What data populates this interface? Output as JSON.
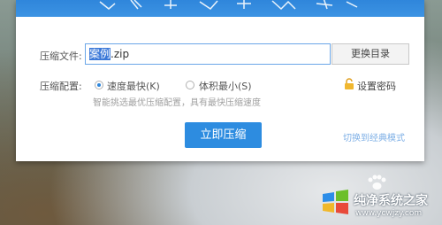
{
  "dialog": {
    "file_label": "压缩文件:",
    "file_name_selected": "案例",
    "file_name_ext": ".zip",
    "change_dir_label": "更换目录",
    "config_label": "压缩配置:",
    "options": [
      {
        "label": "速度最快(K)",
        "checked": true
      },
      {
        "label": "体积最小(S)",
        "checked": false
      }
    ],
    "hint": "智能挑选最优压缩配置，具有最快压缩速度",
    "set_password": "设置密码",
    "compress_button": "立即压缩",
    "classic_mode": "切换到经典模式"
  },
  "watermark": {
    "title": "纯净系统之家",
    "url": "www.ycwjzy.com"
  },
  "colors": {
    "accent": "#2d8ce0",
    "header": "#3389dd",
    "link": "#7fb0e6"
  }
}
